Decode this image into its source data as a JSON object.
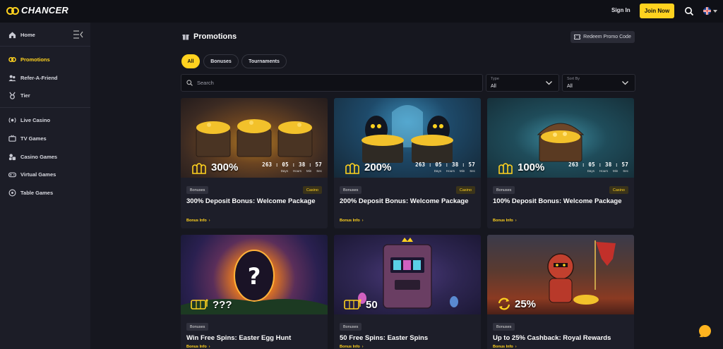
{
  "topbar": {
    "brand": "CHANCER",
    "signin": "Sign In",
    "join": "Join Now"
  },
  "sidebar": {
    "items": [
      {
        "label": "Home",
        "icon": "home-icon"
      },
      {
        "label": "Promotions",
        "icon": "gift-icon",
        "active": true
      },
      {
        "label": "Refer-A-Friend",
        "icon": "users-icon"
      },
      {
        "label": "Tier",
        "icon": "medal-icon"
      },
      {
        "label": "Live Casino",
        "icon": "live-icon"
      },
      {
        "label": "TV Games",
        "icon": "tv-icon"
      },
      {
        "label": "Casino Games",
        "icon": "casino-icon"
      },
      {
        "label": "Virtual Games",
        "icon": "gamepad-icon"
      },
      {
        "label": "Table Games",
        "icon": "roulette-icon"
      }
    ]
  },
  "page": {
    "title": "Promotions",
    "redeem": "Redeem Promo Code"
  },
  "filters": {
    "chips": [
      "All",
      "Bonuses",
      "Tournaments"
    ],
    "search_placeholder": "Search",
    "type_label": "Type",
    "type_value": "All",
    "sort_label": "Sort By",
    "sort_value": "All"
  },
  "colors": {
    "accent": "#ffd21f",
    "bg": "#16171f",
    "card": "#1d1e29"
  },
  "cards": [
    {
      "value": "300%",
      "timer": "263 : 05 : 38 : 57",
      "units": [
        "Days",
        "Hours",
        "Min",
        "Sec"
      ],
      "tag": "Bonuses",
      "category": "Casino",
      "title": "300% Deposit Bonus: Welcome Package",
      "link": "Bonus Info"
    },
    {
      "value": "200%",
      "timer": "263 : 05 : 38 : 57",
      "units": [
        "Days",
        "Hours",
        "Min",
        "Sec"
      ],
      "tag": "Bonuses",
      "category": "Casino",
      "title": "200% Deposit Bonus: Welcome Package",
      "link": "Bonus Info"
    },
    {
      "value": "100%",
      "timer": "263 : 05 : 38 : 57",
      "units": [
        "Days",
        "Hours",
        "Min",
        "Sec"
      ],
      "tag": "Bonuses",
      "category": "Casino",
      "title": "100% Deposit Bonus: Welcome Package",
      "link": "Bonus Info"
    },
    {
      "value": "???",
      "tag": "Bonuses",
      "title": "Win Free Spins: Easter Egg Hunt",
      "link": "Bonus Info"
    },
    {
      "value": "50",
      "tag": "Bonuses",
      "title": "50 Free Spins: Easter Spins",
      "link": "Bonus Info"
    },
    {
      "value": "25%",
      "tag": "Bonuses",
      "title": "Up to 25% Cashback: Royal Rewards",
      "link": "Bonus Info"
    }
  ]
}
